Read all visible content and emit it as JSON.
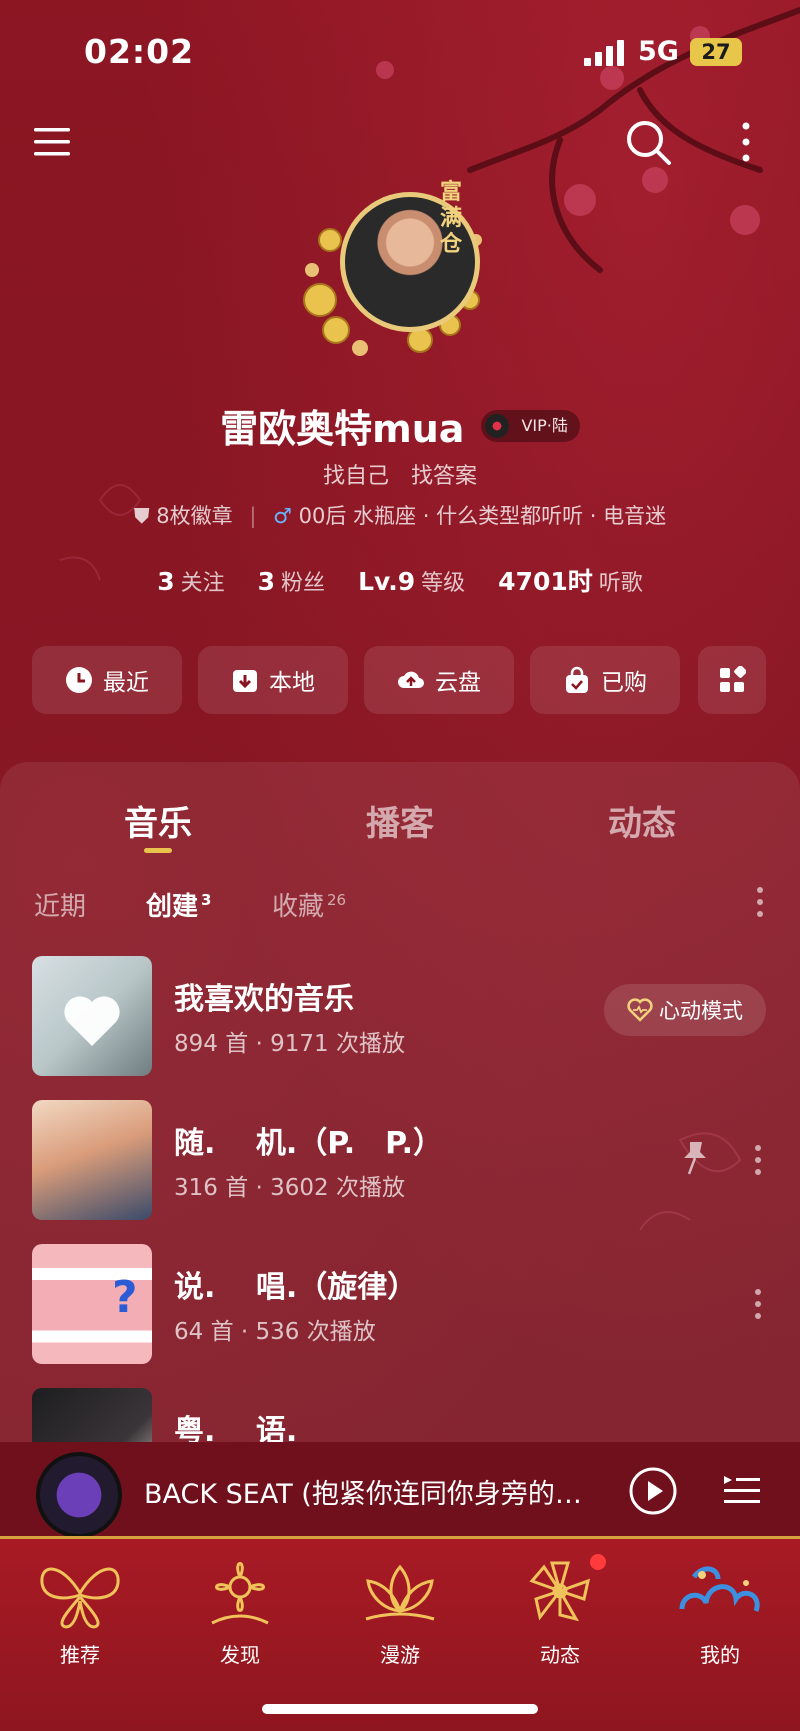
{
  "status_bar": {
    "time": "02:02",
    "network": "5G",
    "battery": "27"
  },
  "profile": {
    "avatar_badge": "富满仓",
    "nickname": "雷欧奥特mua",
    "vip_label": "VIP·陆",
    "signature": "找自己　找答案",
    "badges": "8枚徽章",
    "tags": "00后 水瓶座",
    "tag2": "什么类型都听听",
    "tag3": "电音迷",
    "stats": {
      "following": {
        "value": "3",
        "label": "关注"
      },
      "followers": {
        "value": "3",
        "label": "粉丝"
      },
      "level": {
        "value": "Lv.9",
        "label": "等级"
      },
      "hours": {
        "value": "4701时",
        "label": "听歌"
      }
    }
  },
  "quick_actions": {
    "recent": "最近",
    "local": "本地",
    "cloud": "云盘",
    "purchased": "已购"
  },
  "tabs": {
    "music": "音乐",
    "podcast": "播客",
    "moments": "动态"
  },
  "subtabs": {
    "recent": "近期",
    "created": "创建",
    "created_count": "3",
    "collected": "收藏",
    "collected_count": "26"
  },
  "playlists": [
    {
      "name": "我喜欢的音乐",
      "meta": "894 首 · 9171 次播放",
      "action": "心动模式"
    },
    {
      "name": "随.　 机.（P.　P.）",
      "meta": "316 首 · 3602 次播放"
    },
    {
      "name": "说.　 唱.（旋律）",
      "meta": "64 首 · 536 次播放"
    },
    {
      "name": "粤.　 语.",
      "meta": ""
    }
  ],
  "player": {
    "track": "BACK SEAT (抱紧你连同你身旁的…"
  },
  "nav": {
    "recommend": "推荐",
    "discover": "发现",
    "roam": "漫游",
    "moments": "动态",
    "mine": "我的"
  },
  "colors": {
    "background": "#8a1522",
    "accent_gold": "#e9c34e",
    "nav": "#a81a24"
  }
}
